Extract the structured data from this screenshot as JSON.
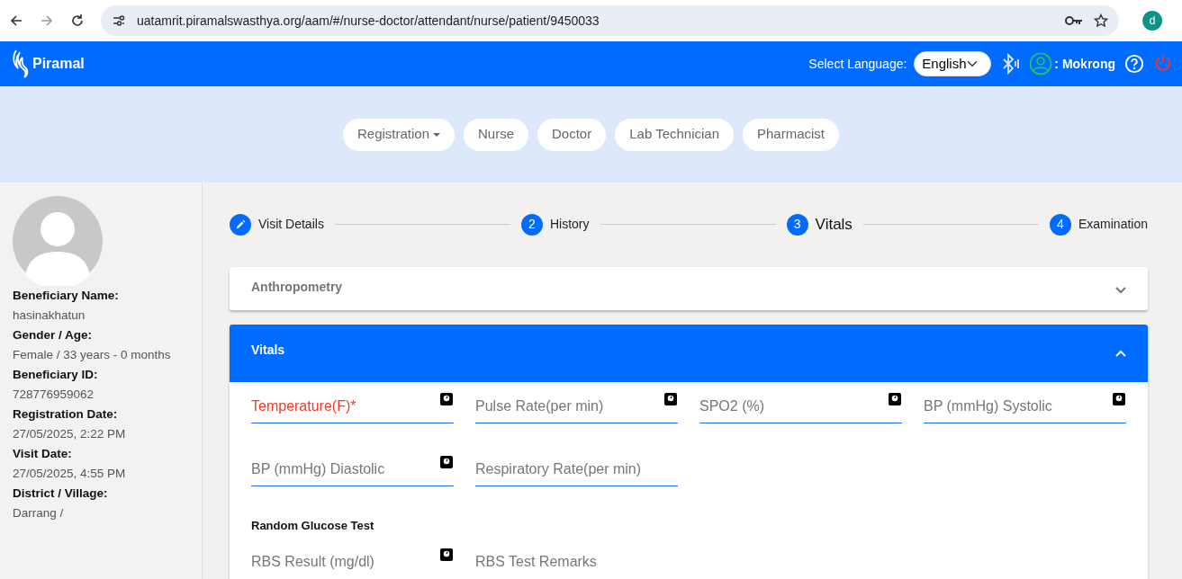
{
  "browser": {
    "url": "uatamrit.piramalswasthya.org/aam/#/nurse-doctor/attendant/nurse/patient/9450033",
    "profile_initial": "d"
  },
  "header": {
    "brand": "Piramal",
    "language_label": "Select Language:",
    "language": "English",
    "user": ": Mokrong"
  },
  "roles": [
    {
      "label": "Registration",
      "dropdown": true
    },
    {
      "label": "Nurse",
      "dropdown": false
    },
    {
      "label": "Doctor",
      "dropdown": false
    },
    {
      "label": "Lab Technician",
      "dropdown": false
    },
    {
      "label": "Pharmacist",
      "dropdown": false
    }
  ],
  "beneficiary": [
    {
      "label": "Beneficiary Name:",
      "value": "hasinakhatun"
    },
    {
      "label": "Gender / Age:",
      "value": "Female / 33 years - 0 months"
    },
    {
      "label": "Beneficiary ID:",
      "value": "728776959062"
    },
    {
      "label": "Registration Date:",
      "value": "27/05/2025, 2:22 PM"
    },
    {
      "label": "Visit Date:",
      "value": "27/05/2025, 4:55 PM"
    },
    {
      "label": "District / Village:",
      "value": "Darrang /"
    }
  ],
  "steps": [
    {
      "kind": "edit",
      "label": "Visit Details",
      "selected": false
    },
    {
      "kind": "number",
      "number": "2",
      "label": "History",
      "selected": false
    },
    {
      "kind": "number",
      "number": "3",
      "label": "Vitals",
      "selected": true
    },
    {
      "kind": "number",
      "number": "4",
      "label": "Examination",
      "selected": false
    }
  ],
  "sections": [
    {
      "title": "Anthropometry",
      "expanded": false
    },
    {
      "title": "Vitals",
      "expanded": true,
      "groups": [
        {
          "fields": [
            {
              "placeholder": "Temperature(F)*",
              "required": true,
              "device": true
            },
            {
              "placeholder": "Pulse Rate(per min)",
              "required": false,
              "device": true
            },
            {
              "placeholder": "SPO2 (%)",
              "required": false,
              "device": true
            },
            {
              "placeholder": "BP (mmHg) Systolic",
              "required": false,
              "device": true
            }
          ]
        },
        {
          "fields": [
            {
              "placeholder": "BP (mmHg) Diastolic",
              "required": false,
              "device": true
            },
            {
              "placeholder": "Respiratory Rate(per min)",
              "required": false,
              "device": false
            }
          ]
        },
        {
          "heading": "Random Glucose Test",
          "fields": [
            {
              "placeholder": "RBS Result (mg/dl)",
              "required": false,
              "device": true
            },
            {
              "placeholder": "RBS Test Remarks",
              "required": false,
              "device": false
            }
          ]
        }
      ]
    }
  ]
}
